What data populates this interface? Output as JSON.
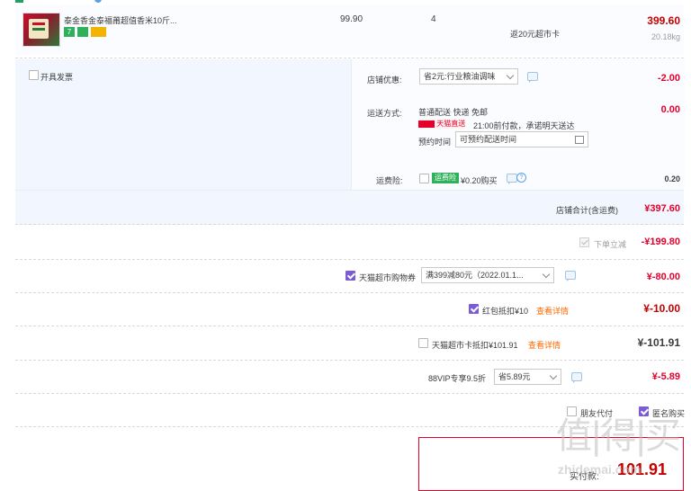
{
  "product": {
    "name": "泰金香金泰福莆超值香米10斤...",
    "unit_price": "99.90",
    "quantity": "4",
    "rebate": "返20元超市卡",
    "subtotal": "399.60",
    "weight": "20.18kg",
    "tags": [
      "7",
      "",
      ""
    ]
  },
  "invoice": {
    "label": "开具发票"
  },
  "shop_discount": {
    "label": "店铺优惠:",
    "selected": "省2元:行业粮油调味",
    "amount": "-2.00"
  },
  "shipping": {
    "label": "运送方式:",
    "method": "普通配送 快递 免邮",
    "badge": "天猫直送",
    "promise": "21:00前付款，承诺明天送达",
    "schedule_label": "预约时间",
    "schedule_placeholder": "可预约配送时间",
    "amount": "0.00"
  },
  "insurance": {
    "label": "运费险:",
    "badge": "运费险",
    "price": "¥0.20购买",
    "amount": "0.20"
  },
  "shop_total": {
    "label": "店铺合计(含运费)",
    "amount": "¥397.60"
  },
  "order_discount": {
    "label": "下单立减",
    "amount": "-¥199.80"
  },
  "supermarket_coupon": {
    "label": "天猫超市购物券",
    "selected": "满399减80元（2022.01.1...",
    "amount": "¥-80.00"
  },
  "red_packet": {
    "label": "红包抵扣¥10",
    "detail": "查看详情",
    "amount": "¥-10.00"
  },
  "supermarket_card": {
    "label": "天猫超市卡抵扣¥101.91",
    "detail": "查看详情",
    "amount": "¥-101.91"
  },
  "vip": {
    "label": "88VIP专享9.5折",
    "selected": "省5.89元",
    "amount": "¥-5.89"
  },
  "options": {
    "friend_pay": "朋友代付",
    "anonymous": "匿名购买"
  },
  "payment": {
    "label": "实付款:",
    "amount": "101.91"
  },
  "watermark": {
    "text": "值|得|买",
    "url": "zhidemai.com"
  }
}
